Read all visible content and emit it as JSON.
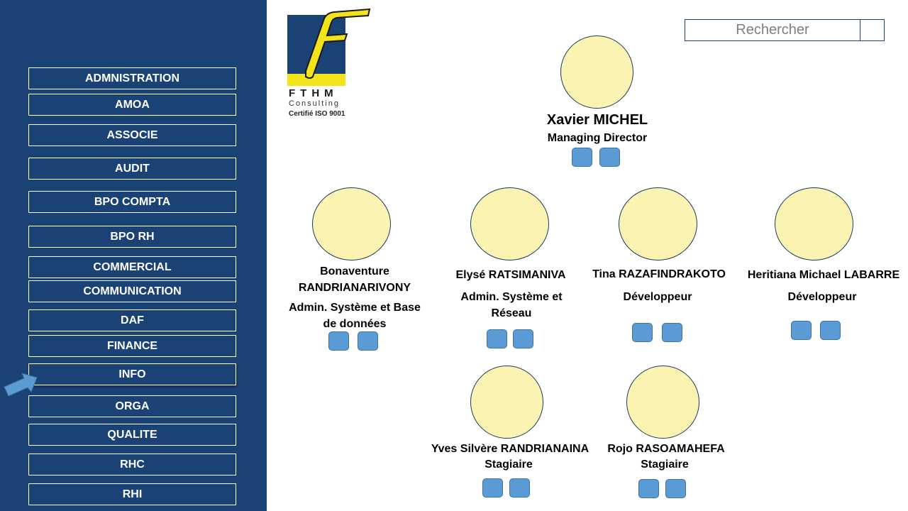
{
  "sidebar": {
    "items": [
      {
        "label": "ADMNISTRATION"
      },
      {
        "label": "AMOA"
      },
      {
        "label": "ASSOCIE"
      },
      {
        "label": "AUDIT"
      },
      {
        "label": "BPO COMPTA"
      },
      {
        "label": "BPO RH"
      },
      {
        "label": "COMMERCIAL"
      },
      {
        "label": "COMMUNICATION"
      },
      {
        "label": "DAF"
      },
      {
        "label": "FINANCE"
      },
      {
        "label": "INFO"
      },
      {
        "label": "ORGA"
      },
      {
        "label": "QUALITE"
      },
      {
        "label": "RHC"
      },
      {
        "label": "RHI"
      }
    ],
    "selected": "INFO",
    "pointer_icon": "arrow-right-icon"
  },
  "logo": {
    "letter": "F",
    "name": "FTHM",
    "subtitle": "Consulting",
    "certification": "Certifié ISO 9001"
  },
  "search": {
    "placeholder": "Rechercher"
  },
  "people": [
    {
      "name": "Xavier MICHEL",
      "role": "Managing Director"
    },
    {
      "name": "Bonaventure RANDRIANARIVONY",
      "role": "Admin. Système et Base de données"
    },
    {
      "name": "Elysé RATSIMANIVA",
      "role": "Admin. Système et Réseau"
    },
    {
      "name": "Tina RAZAFINDRAKOTO",
      "role": "Développeur"
    },
    {
      "name": "Heritiana Michael LABARRE",
      "role": "Développeur"
    },
    {
      "name": "Yves Silvère RANDRIANAINA",
      "role": "Stagiaire"
    },
    {
      "name": "Rojo RASOAMAHEFA",
      "role": "Stagiaire"
    }
  ],
  "colors": {
    "sidebar": "#1a4274",
    "avatar_fill": "#fbf3b1",
    "action_icon": "#5b9bd5",
    "logo_yellow": "#f2e31a"
  }
}
